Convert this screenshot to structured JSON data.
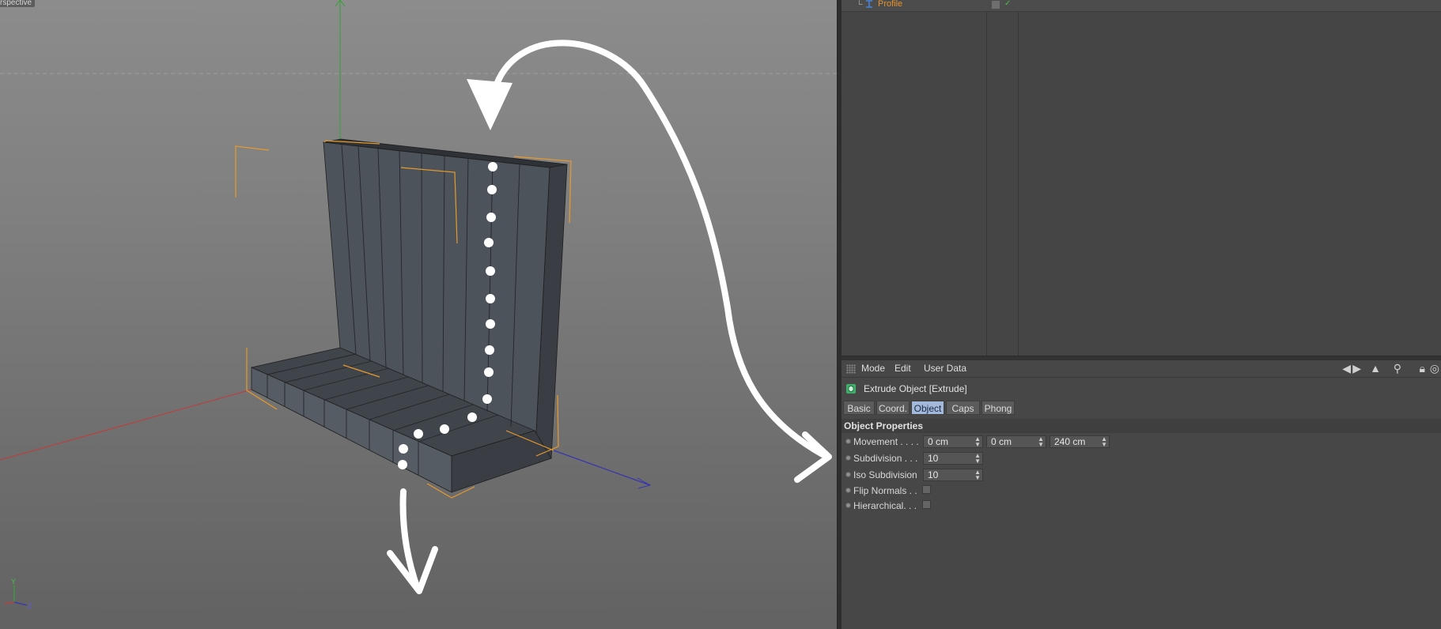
{
  "viewport": {
    "label": "rspective",
    "axis_widget": {
      "y": "Y",
      "z": "Z"
    },
    "colors": {
      "x_axis": "#c43a3a",
      "y_axis": "#35a335",
      "z_axis": "#3535b0",
      "selection": "#e89a2a"
    }
  },
  "object_manager": {
    "rows": [
      {
        "name": "Profile",
        "icon": "spline-profile-icon",
        "tree": "└",
        "check": "✓"
      }
    ]
  },
  "attribute_manager": {
    "menu": [
      "Mode",
      "Edit",
      "User Data"
    ],
    "tools": [
      "back-arrow-icon",
      "forward-arrow-icon",
      "pointer-icon",
      "search-icon",
      "lock-icon",
      "target-icon"
    ],
    "title": "Extrude Object [Extrude]",
    "tabs": [
      {
        "label": "Basic",
        "active": false
      },
      {
        "label": "Coord.",
        "active": false
      },
      {
        "label": "Object",
        "active": true
      },
      {
        "label": "Caps",
        "active": false
      },
      {
        "label": "Phong",
        "active": false
      }
    ],
    "section": "Object Properties",
    "props": {
      "movement": {
        "label": "Movement . . . .",
        "x": "0 cm",
        "y": "0 cm",
        "z": "240 cm"
      },
      "subdivision": {
        "label": "Subdivision . . .",
        "value": "10"
      },
      "iso_subdivision": {
        "label": "Iso Subdivision",
        "value": "10"
      },
      "flip_normals": {
        "label": "Flip Normals . .",
        "checked": false
      },
      "hierarchical": {
        "label": "Hierarchical. . .",
        "checked": false
      }
    }
  }
}
